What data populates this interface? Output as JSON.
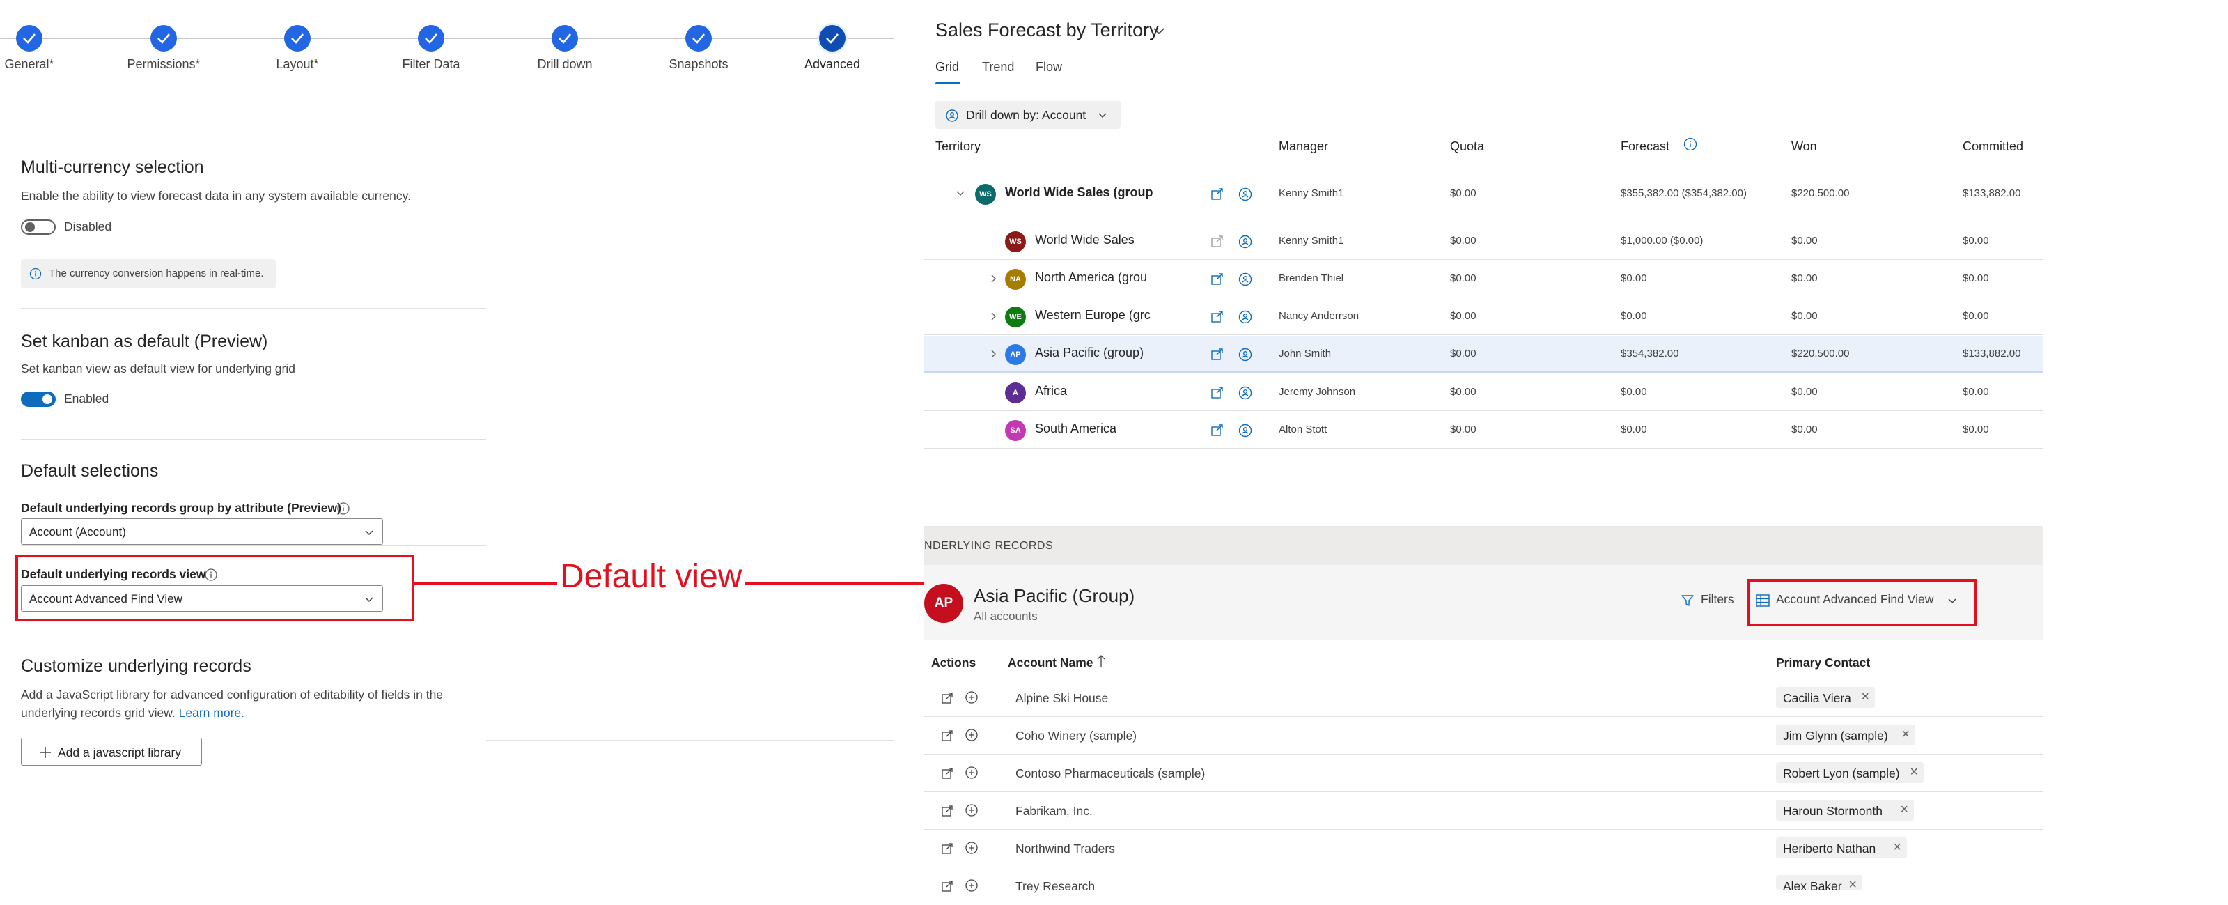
{
  "stepper": {
    "steps": [
      {
        "label": "General*"
      },
      {
        "label": "Permissions*"
      },
      {
        "label": "Layout*"
      },
      {
        "label": "Filter Data"
      },
      {
        "label": "Drill down"
      },
      {
        "label": "Snapshots"
      },
      {
        "label": "Advanced"
      }
    ]
  },
  "settings": {
    "multi_currency": {
      "title": "Multi-currency selection",
      "description": "Enable the ability to view forecast data in any system available currency.",
      "toggle_label": "Disabled",
      "info": "The currency conversion happens in real-time."
    },
    "kanban": {
      "title": "Set kanban as default (Preview)",
      "description": "Set kanban view as default view for underlying grid",
      "toggle_label": "Enabled"
    },
    "default_selections": {
      "title": "Default selections",
      "group_by_label": "Default underlying records group by attribute (Preview)",
      "group_by_value": "Account (Account)",
      "view_label": "Default underlying records view",
      "view_value": "Account Advanced Find View"
    },
    "customize": {
      "title": "Customize underlying records",
      "description_line1": "Add a JavaScript library for advanced configuration of editability of fields in the",
      "description_line2": "underlying records grid view.",
      "learn_more": "Learn more.",
      "button": "Add a javascript library"
    }
  },
  "annotation": {
    "callout": "Default view"
  },
  "forecast": {
    "title": "Sales Forecast by Territory",
    "tabs": [
      "Grid",
      "Trend",
      "Flow"
    ],
    "drill_down": "Drill down by: Account",
    "columns": [
      "Territory",
      "Manager",
      "Quota",
      "Forecast",
      "Won",
      "Committed"
    ],
    "rows": [
      {
        "initials": "WS",
        "territory": "World Wide Sales (group",
        "manager": "Kenny Smith1",
        "quota": "$0.00",
        "forecast": "$355,382.00  ($354,382.00)",
        "won": "$220,500.00",
        "committed": "$133,882.00",
        "color": "#0b6a6a"
      },
      {
        "initials": "WS",
        "territory": "World Wide Sales",
        "manager": "Kenny Smith1",
        "quota": "$0.00",
        "forecast": "$1,000.00  ($0.00)",
        "won": "$0.00",
        "committed": "$0.00",
        "color": "#8b1a1a"
      },
      {
        "initials": "NA",
        "territory": "North America (grou",
        "manager": "Brenden Thiel",
        "quota": "$0.00",
        "forecast": "$0.00",
        "won": "$0.00",
        "committed": "$0.00",
        "color": "#a67c00"
      },
      {
        "initials": "WE",
        "territory": "Western Europe (grc",
        "manager": "Nancy Anderrson",
        "quota": "$0.00",
        "forecast": "$0.00",
        "won": "$0.00",
        "committed": "$0.00",
        "color": "#107c10"
      },
      {
        "initials": "AP",
        "territory": "Asia Pacific (group)",
        "manager": "John Smith",
        "quota": "$0.00",
        "forecast": "$354,382.00",
        "won": "$220,500.00",
        "committed": "$133,882.00",
        "color": "#2c7be5"
      },
      {
        "initials": "A",
        "territory": "Africa",
        "manager": "Jeremy Johnson",
        "quota": "$0.00",
        "forecast": "$0.00",
        "won": "$0.00",
        "committed": "$0.00",
        "color": "#5c2e91"
      },
      {
        "initials": "SA",
        "territory": "South America",
        "manager": "Alton Stott",
        "quota": "$0.00",
        "forecast": "$0.00",
        "won": "$0.00",
        "committed": "$0.00",
        "color": "#c239b3"
      }
    ]
  },
  "underlying": {
    "header": "NDERLYING RECORDS",
    "avatar": "AP",
    "title": "Asia Pacific (Group)",
    "subtitle": "All accounts",
    "filters": "Filters",
    "view": "Account Advanced Find View",
    "columns": {
      "actions": "Actions",
      "account_name": "Account Name",
      "primary_contact": "Primary Contact"
    },
    "records": [
      {
        "account": "Alpine Ski House",
        "contact": "Cacilia Viera"
      },
      {
        "account": "Coho Winery (sample)",
        "contact": "Jim Glynn (sample)"
      },
      {
        "account": "Contoso Pharmaceuticals (sample)",
        "contact": "Robert Lyon (sample)"
      },
      {
        "account": "Fabrikam, Inc.",
        "contact": "Haroun Stormonth"
      },
      {
        "account": "Northwind Traders",
        "contact": "Heriberto Nathan"
      },
      {
        "account": "Trey Research",
        "contact": "Alex Baker"
      }
    ]
  },
  "colors": {
    "accent": "#0f6cbd",
    "step": "#2266e3",
    "callout": "#e3111f"
  }
}
